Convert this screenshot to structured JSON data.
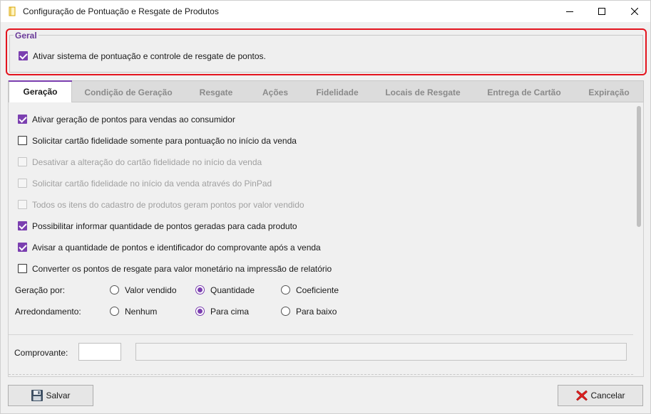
{
  "window": {
    "title": "Configuração de Pontuação e Resgate de Produtos",
    "icon": "app-icon",
    "controls": [
      "minimize-icon",
      "maximize-icon",
      "close-icon"
    ]
  },
  "geral": {
    "legend": "Geral",
    "enable_label": "Ativar sistema de pontuação e controle de resgate de pontos.",
    "enable_checked": true
  },
  "tabs": [
    {
      "label": "Geração",
      "active": true
    },
    {
      "label": "Condição de Geração",
      "active": false
    },
    {
      "label": "Resgate",
      "active": false
    },
    {
      "label": "Ações",
      "active": false
    },
    {
      "label": "Fidelidade",
      "active": false
    },
    {
      "label": "Locais de Resgate",
      "active": false
    },
    {
      "label": "Entrega de Cartão",
      "active": false
    },
    {
      "label": "Expiração",
      "active": false
    }
  ],
  "options": [
    {
      "label": "Ativar geração de pontos para vendas ao consumidor",
      "checked": true,
      "enabled": true
    },
    {
      "label": "Solicitar cartão fidelidade somente para pontuação no início da venda",
      "checked": false,
      "enabled": true
    },
    {
      "label": "Desativar a alteração do cartão fidelidade no início da venda",
      "checked": false,
      "enabled": false
    },
    {
      "label": "Solicitar cartão fidelidade no início da venda através do PinPad",
      "checked": false,
      "enabled": false
    },
    {
      "label": "Todos os itens do cadastro de produtos geram pontos por valor vendido",
      "checked": false,
      "enabled": false
    },
    {
      "label": "Possibilitar informar quantidade de pontos geradas para cada produto",
      "checked": true,
      "enabled": true
    },
    {
      "label": "Avisar a quantidade de pontos e identificador do comprovante após a venda",
      "checked": true,
      "enabled": true
    },
    {
      "label": "Converter os pontos de resgate para valor monetário na impressão de relatório",
      "checked": false,
      "enabled": true
    }
  ],
  "geracao_por": {
    "label": "Geração por:",
    "options": [
      "Valor vendido",
      "Quantidade",
      "Coeficiente"
    ],
    "selected": "Quantidade"
  },
  "arredondamento": {
    "label": "Arredondamento:",
    "options": [
      "Nenhum",
      "Para cima",
      "Para baixo"
    ],
    "selected": "Para cima"
  },
  "comprovante": {
    "label": "Comprovante:",
    "code_value": "",
    "description_value": ""
  },
  "buttons": {
    "save": "Salvar",
    "cancel": "Cancelar"
  },
  "colors": {
    "accent": "#7b3fb0",
    "highlight_border": "#e3141e",
    "legend": "#6a3a99"
  }
}
